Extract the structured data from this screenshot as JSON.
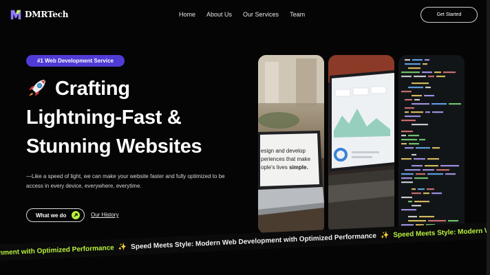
{
  "brand": {
    "name": "DMRTech"
  },
  "nav": {
    "items": [
      {
        "label": "Home"
      },
      {
        "label": "About Us"
      },
      {
        "label": "Our Services"
      },
      {
        "label": "Team"
      }
    ],
    "cta_label": "Get Started"
  },
  "hero": {
    "badge": "#1 Web Development Service",
    "headline_line1": "Crafting",
    "headline_line2": "Lightning-Fast &",
    "headline_line3": "Stunning Websites",
    "subtext": "—Like a speed of light, we can make your website faster and fully optimized to be access in every device, everywhere, everytime.",
    "primary_button": "What we do",
    "secondary_link": "Our History"
  },
  "ticker": {
    "text_green": "Speed Meets Style: Modern Web Development with Optimized Performance",
    "text_white": "Speed Meets Style: Modern Web Development with Optimized Performance",
    "lead_fragment": "onment with Optimized Performance",
    "tail_fragment": "Speed Meets Style: Modern Web Develop"
  },
  "colors": {
    "accent": "#b9f23d",
    "badge": "#4f3cd6",
    "background": "#050505"
  },
  "icons": [
    "logo-mark-icon",
    "rocket-icon",
    "arrow-up-right-icon",
    "sparkle-icon"
  ]
}
